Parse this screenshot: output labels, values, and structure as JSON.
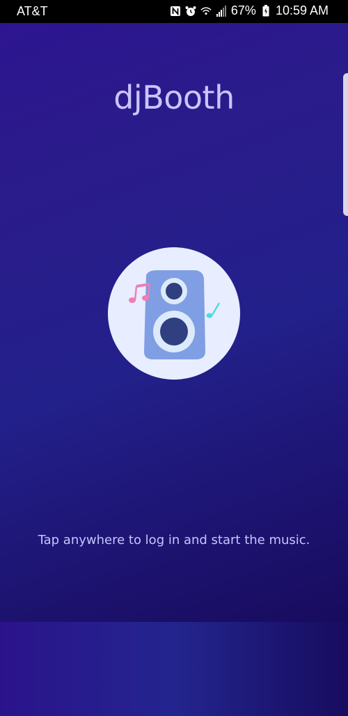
{
  "status_bar": {
    "carrier": "AT&T",
    "battery_percent": "67%",
    "time": "10:59 AM",
    "icons": [
      "nfc-icon",
      "alarm-icon",
      "wifi-icon",
      "signal-icon",
      "battery-icon"
    ]
  },
  "app": {
    "title": "djBooth",
    "tagline": "Tap anywhere to log in and start the music.",
    "logo_icon": "speaker-with-music-notes-icon"
  },
  "colors": {
    "background": "#24197e",
    "title": "#c9c6ff",
    "tagline": "#c8c4ff",
    "logo_circle": "#e8eeff",
    "speaker_body": "#7f9ee3",
    "speaker_cone": "#2f3f7f",
    "note_pink": "#ee7fb6",
    "note_cyan": "#4fd9e6"
  }
}
